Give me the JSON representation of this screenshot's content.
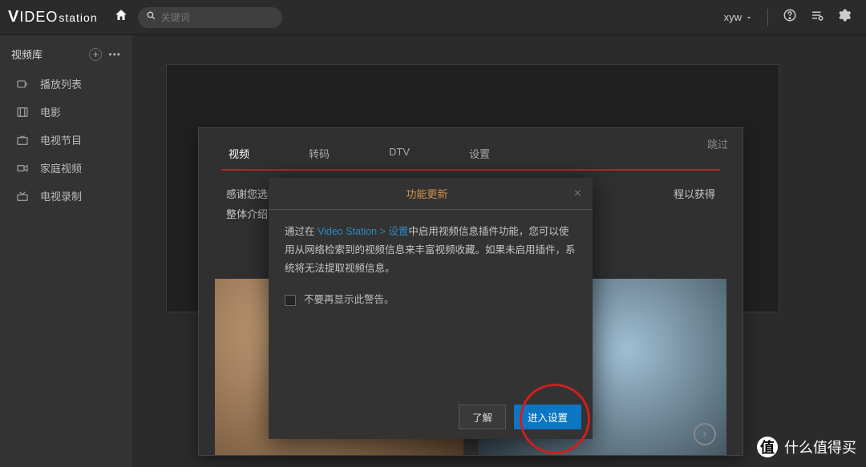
{
  "topbar": {
    "logo_left": "V",
    "logo_mid": "IDEO",
    "logo_right": "station",
    "search_placeholder": "关键词",
    "user_name": "xyw"
  },
  "sidebar": {
    "title": "视频库",
    "items": [
      {
        "label": "播放列表"
      },
      {
        "label": "电影"
      },
      {
        "label": "电视节目"
      },
      {
        "label": "家庭视频"
      },
      {
        "label": "电视录制"
      }
    ]
  },
  "wizard": {
    "skip_label": "跳过",
    "tabs": [
      "视频",
      "转码",
      "DTV",
      "设置"
    ],
    "body_line1": "感谢您选择",
    "body_line1_tail": "程以获得",
    "body_line2": "整体介绍，"
  },
  "modal": {
    "title": "功能更新",
    "body_pre": "通过在 ",
    "body_link": "Video Station > 设置",
    "body_post": "中启用视频信息插件功能，您可以使用从网络检索到的视频信息来丰富视频收藏。如果未启用插件，系统将无法提取视频信息。",
    "checkbox_label": "不要再显示此警告。",
    "btn_cancel": "了解",
    "btn_primary": "进入设置"
  },
  "watermark": {
    "badge": "值",
    "text": "什么值得买"
  }
}
